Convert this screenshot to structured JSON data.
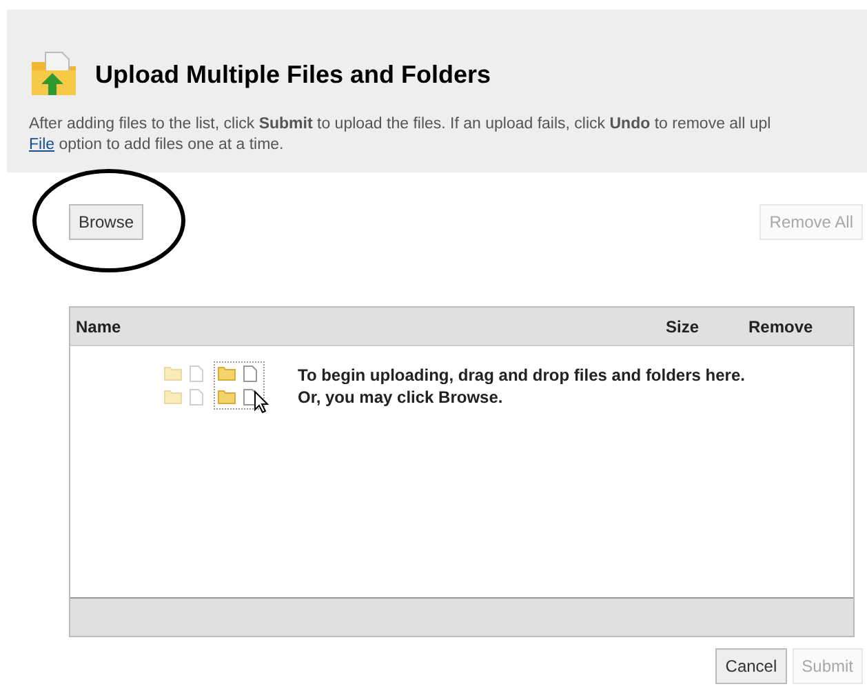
{
  "header": {
    "title": "Upload Multiple Files and Folders",
    "description": {
      "text": "After adding files to the list, click **Submit** to upload the files. If an upload fails, click **Undo** to remove all upl",
      "link": "File",
      "rest": " option to add files one at a time."
    }
  },
  "toolbar": [
    {
      "label": "Browse",
      "disabled": false,
      "circled": true
    },
    {
      "label": "Remove All",
      "disabled": true,
      "circled": false
    }
  ],
  "table": {
    "columns": [
      "Name",
      "Size",
      "Remove"
    ],
    "drop_hint": [
      "To begin uploading, drag and drop files and folders here.",
      "Or, you may click Browse."
    ]
  },
  "footer_buttons": [
    {
      "label": "Cancel",
      "disabled": false
    },
    {
      "label": "Submit",
      "disabled": true
    }
  ]
}
